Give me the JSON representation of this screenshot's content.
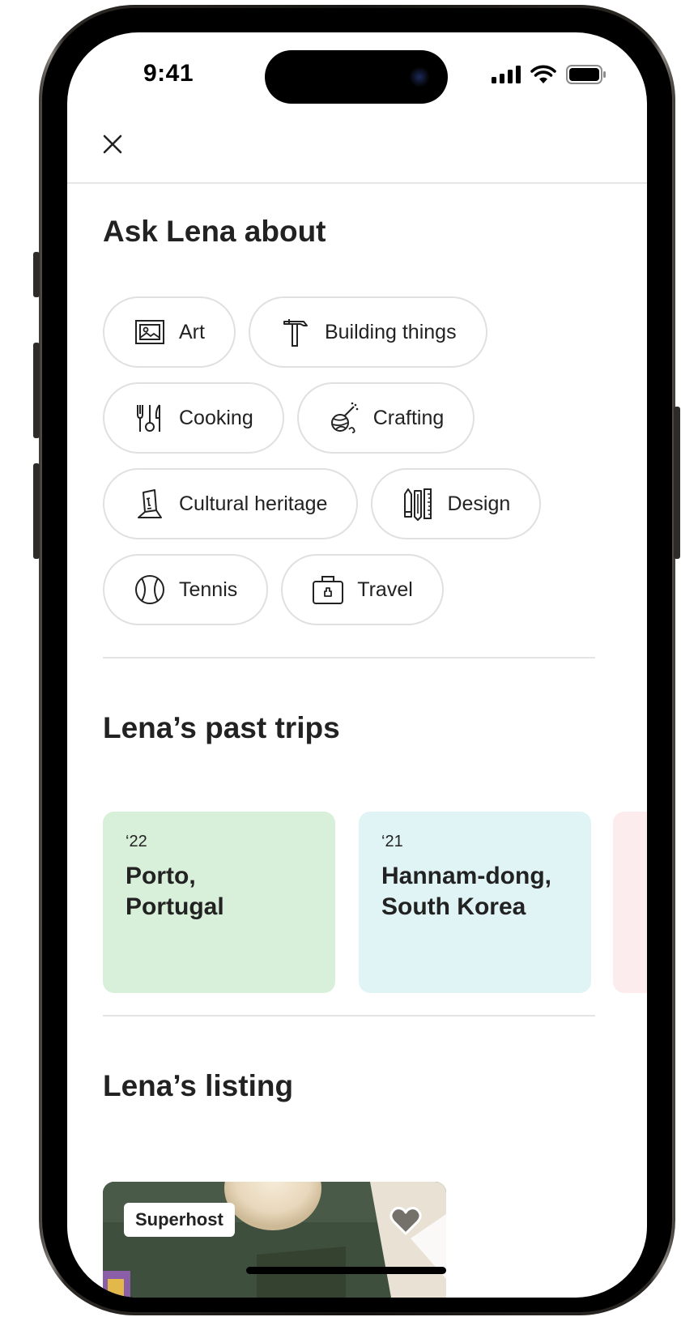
{
  "status_bar": {
    "time": "9:41"
  },
  "header": {
    "close_icon": "close-icon"
  },
  "ask": {
    "title": "Ask Lena about",
    "chips": [
      {
        "label": "Art",
        "icon": "picture-frame-icon"
      },
      {
        "label": "Building things",
        "icon": "hammer-icon"
      },
      {
        "label": "Cooking",
        "icon": "utensils-icon"
      },
      {
        "label": "Crafting",
        "icon": "yarn-ball-icon"
      },
      {
        "label": "Cultural heritage",
        "icon": "moai-statue-icon"
      },
      {
        "label": "Design",
        "icon": "design-tools-icon"
      },
      {
        "label": "Tennis",
        "icon": "tennis-ball-icon"
      },
      {
        "label": "Travel",
        "icon": "suitcase-icon"
      }
    ]
  },
  "trips": {
    "title": "Lena’s past trips",
    "cards": [
      {
        "year": "‘22",
        "place_line1": "Porto,",
        "place_line2": "Portugal",
        "color": "#d8efd9"
      },
      {
        "year": "‘21",
        "place_line1": "Hannam-dong,",
        "place_line2": "South Korea",
        "color": "#e0f4f5"
      },
      {
        "color": "#fdecee"
      }
    ]
  },
  "listing": {
    "title": "Lena’s listing",
    "badge": "Superhost",
    "heart_icon": "heart-icon"
  }
}
